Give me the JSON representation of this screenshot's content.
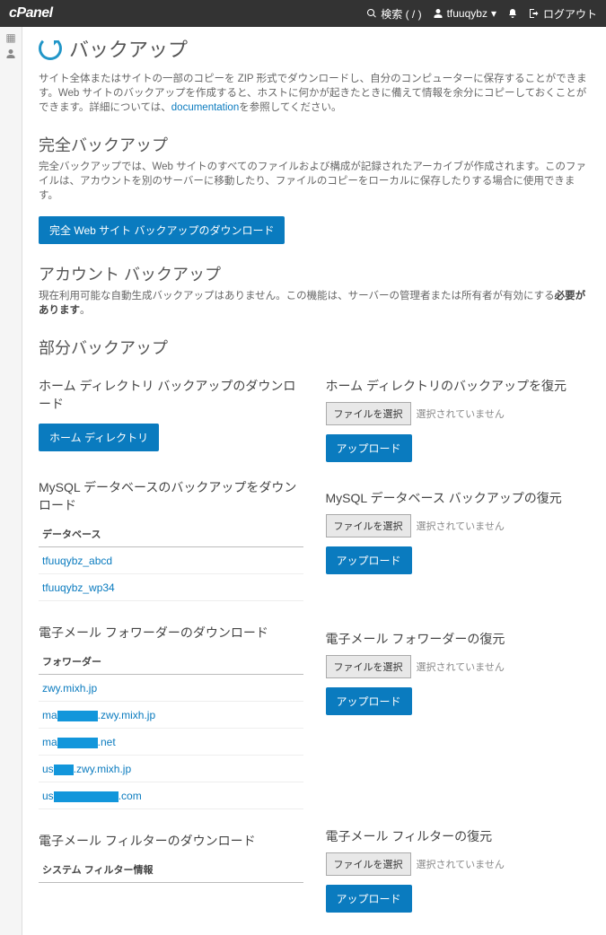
{
  "brand": "cPanel",
  "topbar": {
    "search": "検索 ( / )",
    "user": "tfuuqybz",
    "logout": "ログアウト"
  },
  "page": {
    "title": "バックアップ",
    "intro_pre": "サイト全体またはサイトの一部のコピーを ZIP 形式でダウンロードし、自分のコンピューターに保存することができます。Web サイトのバックアップを作成すると、ホストに何かが起きたときに備えて情報を余分にコピーしておくことができます。詳細については、",
    "intro_link": "documentation",
    "intro_post": "を参照してください。"
  },
  "full": {
    "heading": "完全バックアップ",
    "desc": "完全バックアップでは、Web サイトのすべてのファイルおよび構成が記録されたアーカイブが作成されます。このファイルは、アカウントを別のサーバーに移動したり、ファイルのコピーをローカルに保存したりする場合に使用できます。",
    "button": "完全 Web サイト バックアップのダウンロード"
  },
  "account": {
    "heading": "アカウント バックアップ",
    "desc_pre": "現在利用可能な自動生成バックアップはありません。この機能は、サーバーの管理者または所有者が有効にする",
    "desc_bold": "必要があります",
    "desc_post": "。"
  },
  "partial": {
    "heading": "部分バックアップ"
  },
  "left": {
    "home_heading": "ホーム ディレクトリ バックアップのダウンロード",
    "home_button": "ホーム ディレクトリ",
    "mysql_heading": "MySQL データベースのバックアップをダウンロード",
    "mysql_th": "データベース",
    "mysql_rows": [
      "tfuuqybz_abcd",
      "tfuuqybz_wp34"
    ],
    "fwd_heading": "電子メール フォワーダーのダウンロード",
    "fwd_th": "フォワーダー",
    "fwd_rows": [
      {
        "pre": "zwy.mixh.jp",
        "mask": 0,
        "post": ""
      },
      {
        "pre": "ma",
        "mask": 45,
        "post": ".zwy.mixh.jp"
      },
      {
        "pre": "ma",
        "mask": 45,
        "post": ".net"
      },
      {
        "pre": "us",
        "mask": 22,
        "post": ".zwy.mixh.jp"
      },
      {
        "pre": "us",
        "mask": 72,
        "post": ".com"
      }
    ],
    "filter_heading": "電子メール フィルターのダウンロード",
    "filter_th": "システム フィルター情報"
  },
  "right": {
    "home_heading": "ホーム ディレクトリのバックアップを復元",
    "mysql_heading": "MySQL データベース バックアップの復元",
    "fwd_heading": "電子メール フォワーダーの復元",
    "filter_heading": "電子メール フィルターの復元",
    "file_button": "ファイルを選択",
    "file_none": "選択されていません",
    "upload": "アップロード"
  }
}
